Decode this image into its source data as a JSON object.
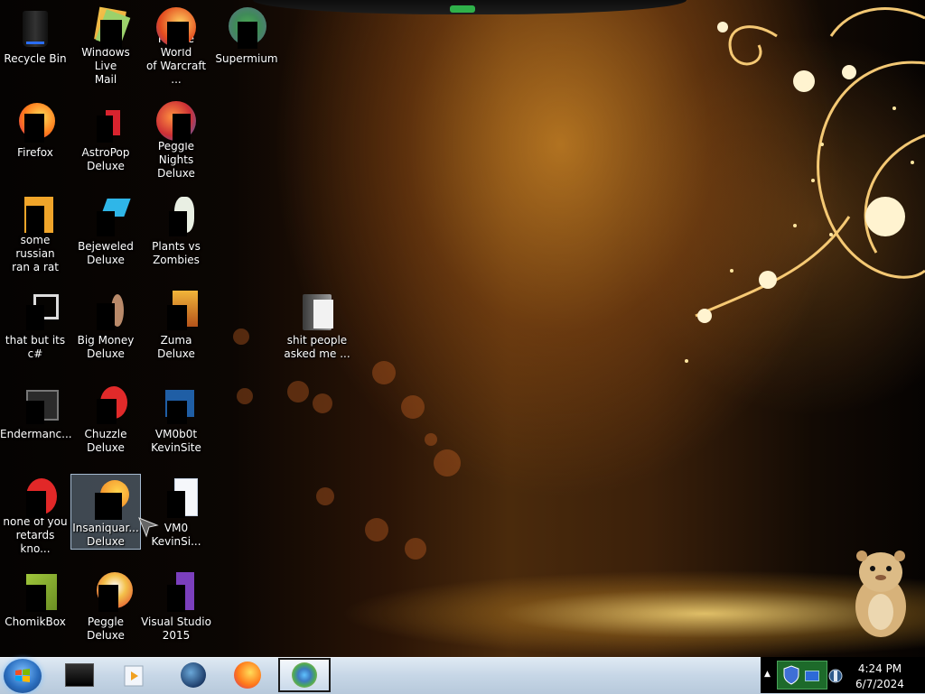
{
  "desktop": {
    "icons": [
      {
        "label": "Recycle Bin"
      },
      {
        "label": "Windows Live\nMail"
      },
      {
        "label": "Peggle World\nof Warcraft ..."
      },
      {
        "label": "Supermium"
      },
      {
        "label": "Firefox"
      },
      {
        "label": "AstroPop\nDeluxe"
      },
      {
        "label": "Peggle Nights\nDeluxe"
      },
      {
        "label": "some russian\nran a rat"
      },
      {
        "label": "Bejeweled\nDeluxe"
      },
      {
        "label": "Plants vs\nZombies"
      },
      {
        "label": "that but its c#"
      },
      {
        "label": "Big Money\nDeluxe"
      },
      {
        "label": "Zuma Deluxe"
      },
      {
        "label": "shit people\nasked me ..."
      },
      {
        "label": "Endermanc..."
      },
      {
        "label": "Chuzzle\nDeluxe"
      },
      {
        "label": "VM0b0t\nKevinSite"
      },
      {
        "label": "none of you\nretards kno..."
      },
      {
        "label": "Insaniquar...\nDeluxe"
      },
      {
        "label": "VM0\nKevinSi..."
      },
      {
        "label": "ChomikBox"
      },
      {
        "label": "Peggle Deluxe"
      },
      {
        "label": "Visual Studio\n2015"
      }
    ]
  },
  "taskbar": {
    "pinned": [
      {
        "icon": "terminal-icon"
      },
      {
        "icon": "media-player-icon"
      },
      {
        "icon": "globe-app-icon"
      },
      {
        "icon": "firefox-icon"
      },
      {
        "icon": "supermium-icon"
      }
    ],
    "clock": {
      "time": "4:24 PM",
      "date": "6/7/2024"
    }
  },
  "colors": {
    "taskbar": "#c6d6e6",
    "selection": "#aac8e6",
    "accent": "#2fb14a"
  }
}
